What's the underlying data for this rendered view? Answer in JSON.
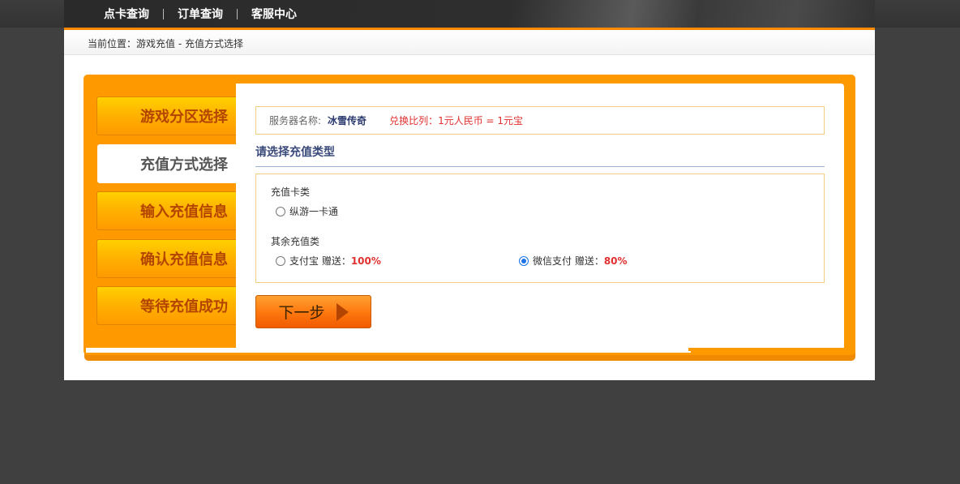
{
  "nav": {
    "items": [
      "点卡查询",
      "订单查询",
      "客服中心"
    ]
  },
  "breadcrumb": "当前位置：游戏充值 - 充值方式选择",
  "steps": [
    "游戏分区选择",
    "充值方式选择",
    "输入充值信息",
    "确认充值信息",
    "等待充值成功"
  ],
  "active_step": 1,
  "server": {
    "label": "服务器名称:",
    "name": "冰雪传奇",
    "exchange": "兑换比列：1元人民币 = 1元宝"
  },
  "section_title": "请选择充值类型",
  "card_group": {
    "label": "充值卡类",
    "options": [
      {
        "label": "纵游一卡通",
        "checked": false
      }
    ]
  },
  "other_group": {
    "label": "其余充值类",
    "options": [
      {
        "label": "支付宝 赠送：",
        "bonus": "100%",
        "checked": false
      },
      {
        "label": "微信支付 赠送：",
        "bonus": "80%",
        "checked": true
      }
    ]
  },
  "next_button": "下一步",
  "colors": {
    "accent": "#ff9900",
    "background": "#404040",
    "highlight": "#e03030",
    "title": "#3a4a7a"
  }
}
